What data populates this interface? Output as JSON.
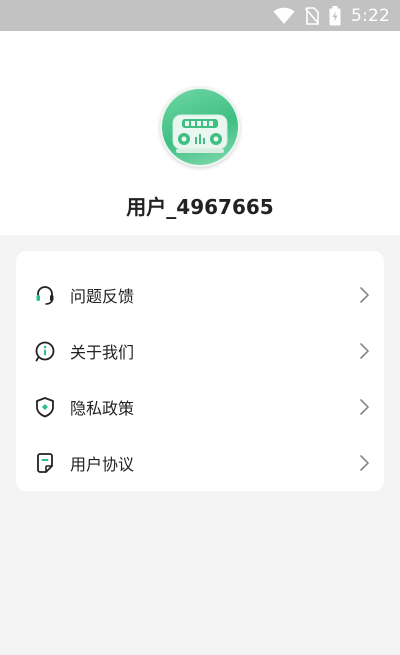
{
  "status_bar": {
    "time": "5:22",
    "icons": [
      "wifi-icon",
      "no-sim-icon",
      "battery-charging-icon"
    ]
  },
  "profile": {
    "avatar_icon": "radio-avatar-icon",
    "username": "用户_4967665"
  },
  "menu": {
    "items": [
      {
        "label": "问题反馈",
        "icon": "headset-icon"
      },
      {
        "label": "关于我们",
        "icon": "info-icon"
      },
      {
        "label": "隐私政策",
        "icon": "shield-icon"
      },
      {
        "label": "用户协议",
        "icon": "document-icon"
      }
    ],
    "accent_color": "#2fbf85"
  }
}
